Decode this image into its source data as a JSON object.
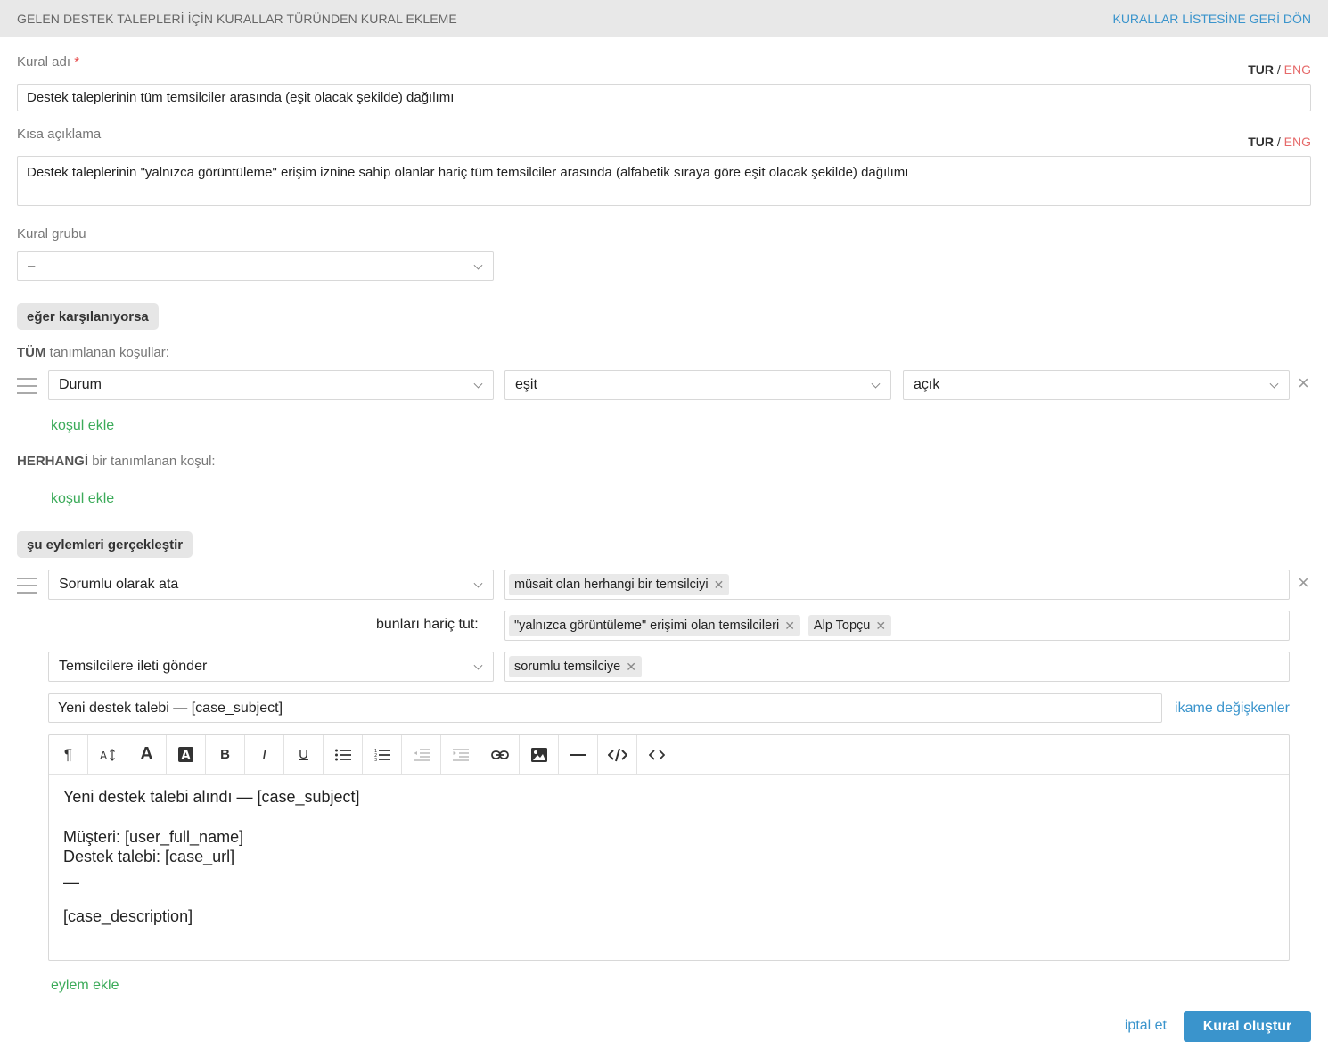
{
  "header": {
    "title": "GELEN DESTEK TALEPLERİ İÇİN KURALLAR TÜRÜNDEN KURAL EKLEME",
    "back_link": "KURALLAR LİSTESİNE GERİ DÖN"
  },
  "lang": {
    "tur": "TUR",
    "sep": "/",
    "eng": "ENG"
  },
  "rule_name": {
    "label": "Kural adı",
    "required_mark": "*",
    "value": "Destek taleplerinin tüm temsilciler arasında (eşit olacak şekilde) dağılımı"
  },
  "short_desc": {
    "label": "Kısa açıklama",
    "value": "Destek taleplerinin \"yalnızca görüntüleme\" erişim iznine sahip olanlar hariç tüm temsilciler arasında (alfabetik sıraya göre eşit olacak şekilde) dağılımı"
  },
  "rule_group": {
    "label": "Kural grubu",
    "value": "–"
  },
  "conditions": {
    "badge": "eğer karşılanıyorsa",
    "all_strong": "TÜM",
    "all_rest": "tanımlanan koşullar:",
    "rows": [
      {
        "field": "Durum",
        "operator": "eşit",
        "value": "açık"
      }
    ],
    "add_all": "koşul ekle",
    "any_strong": "HERHANGİ",
    "any_rest": "bir tanımlanan koşul:",
    "add_any": "koşul ekle"
  },
  "actions": {
    "badge": "şu eylemleri gerçekleştir",
    "action1": {
      "type": "Sorumlu olarak ata",
      "tags": [
        "müsait olan herhangi bir temsilciyi"
      ],
      "except_label": "bunları hariç tut:",
      "except_tags": [
        "\"yalnızca görüntüleme\" erişimi olan temsilcileri",
        "Alp Topçu"
      ]
    },
    "action2": {
      "type": "Temsilcilere ileti gönder",
      "tags": [
        "sorumlu temsilciye"
      ],
      "subject": "Yeni destek talebi  — [case_subject]",
      "vars_link": "ikame değişkenler",
      "body": {
        "line1": "Yeni destek talebi alındı — [case_subject]",
        "line2": "Müşteri: [user_full_name]",
        "line3": "Destek talebi: [case_url]",
        "line4": "—",
        "line5": "[case_description]"
      }
    },
    "add_action": "eylem ekle"
  },
  "footer": {
    "cancel": "iptal et",
    "submit": "Kural oluştur"
  },
  "toolbar_icons": [
    "paragraph-icon",
    "font-size-icon",
    "font-color-icon",
    "background-color-icon",
    "bold-icon",
    "italic-icon",
    "underline-icon",
    "bulleted-list-icon",
    "numbered-list-icon",
    "outdent-icon",
    "indent-icon",
    "link-icon",
    "image-icon",
    "horizontal-rule-icon",
    "code-view-icon",
    "source-icon"
  ],
  "colors": {
    "accent": "#3a94cc",
    "green_link": "#3cab5a",
    "required": "#e64a4a"
  }
}
